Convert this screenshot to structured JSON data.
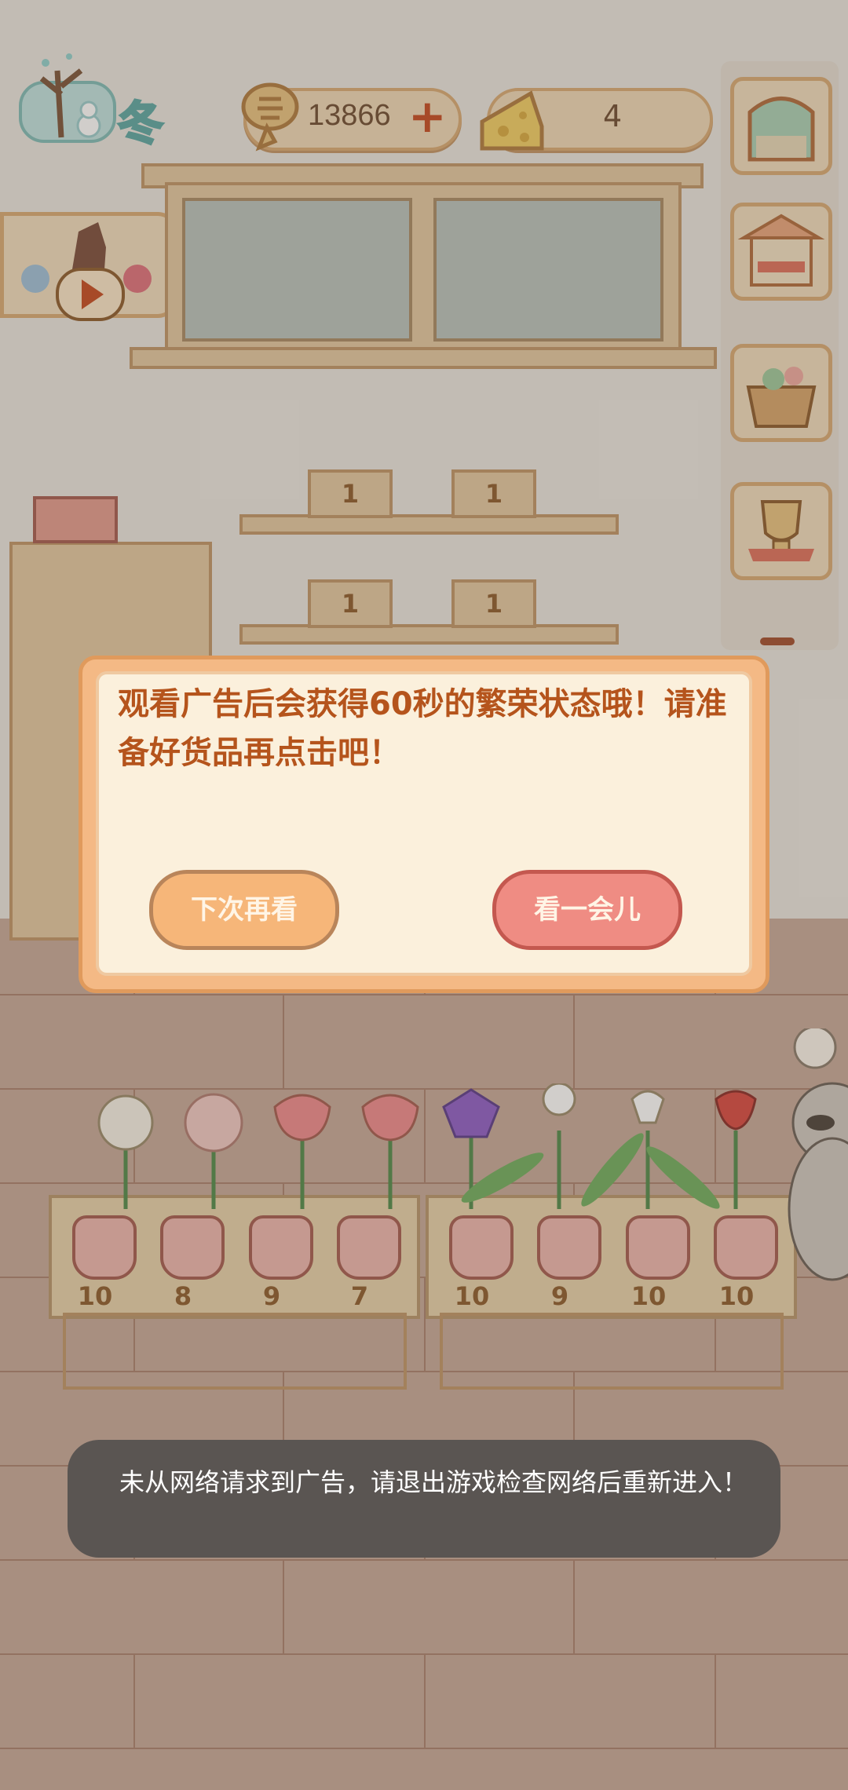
{
  "hud": {
    "season_label": "冬",
    "coins": "13866",
    "coin_plus": "+",
    "cheese": "4"
  },
  "shelf": {
    "item_counts": [
      "1",
      "1",
      "1",
      "1"
    ]
  },
  "dialog": {
    "message": "观看广告后会获得60秒的繁荣状态哦！请准备好货品再点击吧！",
    "later_button": "下次再看",
    "watch_button": "看一会儿"
  },
  "plant_tables": {
    "left_counts": [
      "10",
      "8",
      "9",
      "7"
    ],
    "right_counts": [
      "10",
      "9",
      "10",
      "10"
    ]
  },
  "toast": {
    "message": "未从网络请求到广告，请退出游戏检查网络后重新进入！"
  },
  "colors": {
    "accent_orange": "#e09a5c",
    "dialog_text": "#b5541c",
    "watch_button": "#ef8c83",
    "later_button": "#f6b679"
  },
  "icons": [
    "season-winter-icon",
    "fishbone-coin-icon",
    "plus-icon",
    "cheese-icon",
    "window-icon",
    "stall-icon",
    "basket-icon",
    "trophy-icon",
    "video-ad-icon",
    "play-icon"
  ]
}
